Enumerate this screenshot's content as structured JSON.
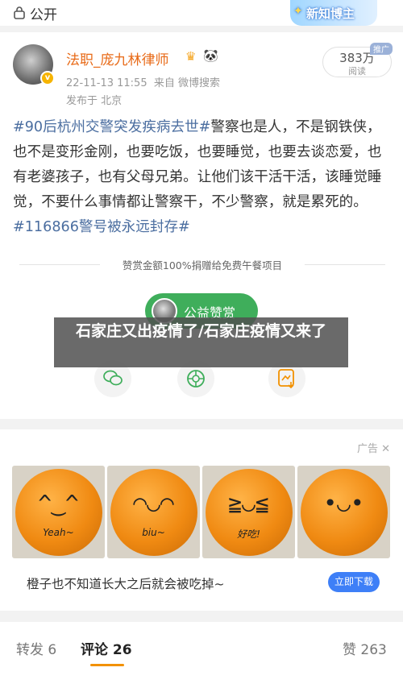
{
  "header": {
    "visibility": "公开",
    "banner": "新知博主"
  },
  "post": {
    "author": "法职_庞九林律师",
    "date": "22-11-13 11:55",
    "source": "来自 微博搜索",
    "location": "发布于 北京",
    "views": {
      "count": "383万",
      "label": "阅读",
      "tag": "推广"
    },
    "hashtag1": "#90后杭州交警突发疾病去世#",
    "body": "警察也是人，不是钢铁侠，也不是变形金刚，也要吃饭，也要睡觉，也要去谈恋爱，也有老婆孩子，也有父母兄弟。让他们该干活干活，该睡觉睡觉，不要什么事情都让警察干，不少警察，就是累死的。",
    "hashtag2": "#116866警号被永远封存#"
  },
  "reward": {
    "note": "赞赏金额100%捐赠给免费午餐项目",
    "button": "公益赞赏"
  },
  "overlay": {
    "title": "石家庄又出疫情了/石家庄疫情又来了"
  },
  "share": [
    {
      "icon": "wechat-icon"
    },
    {
      "icon": "moments-icon"
    },
    {
      "icon": "save-image-icon"
    }
  ],
  "ad": {
    "tag": "广告",
    "close": "✕",
    "images": [
      {
        "face": "^‿^",
        "word": "Yeah~"
      },
      {
        "face": "◠◡◠",
        "word": "biu~"
      },
      {
        "face": "≧◡≦",
        "word": "好吃!"
      },
      {
        "face": "•◡•",
        "word": ""
      }
    ],
    "text": "橙子也不知道长大之后就会被吃掉~",
    "button": "立即下载"
  },
  "tabs": {
    "repost": "转发 6",
    "comment": "评论 26",
    "like": "赞 263"
  }
}
